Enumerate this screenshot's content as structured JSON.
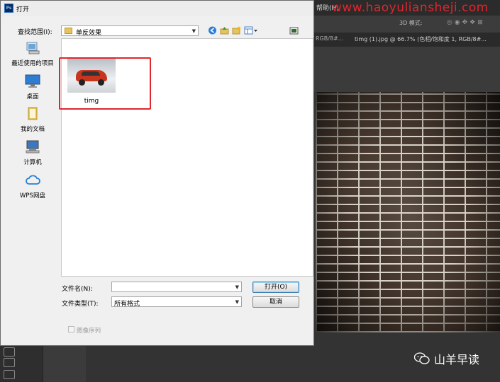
{
  "dialog": {
    "title": "打开",
    "look_in_label": "查找范围(I):",
    "look_in_value": "单反效果",
    "places": [
      {
        "label": "最近使用的项目",
        "icon": "recent-icon"
      },
      {
        "label": "桌面",
        "icon": "desktop-icon"
      },
      {
        "label": "我的文档",
        "icon": "documents-icon"
      },
      {
        "label": "计算机",
        "icon": "computer-icon"
      },
      {
        "label": "WPS网盘",
        "icon": "cloud-icon"
      }
    ],
    "files": [
      {
        "name": "timg",
        "thumbnail": "car-photo"
      }
    ],
    "file_name_label": "文件名(N):",
    "file_name_value": "",
    "file_type_label": "文件类型(T):",
    "file_type_value": "所有格式",
    "open_button": "打开(O)",
    "cancel_button": "取消",
    "image_sequence_label": "图像序列"
  },
  "background": {
    "menu_help": "帮助(H)",
    "watermark": "www.haoyuliansheji.com",
    "options_3d": "3D 模式:",
    "tab_partial": "RGB/8#...",
    "tab_active": "timg (1).jpg @ 66.7% (色相/饱和度 1, RGB/8#...",
    "brand": "山羊早读"
  },
  "colors": {
    "highlight": "#e0262d",
    "dialog_bg": "#f0f0f0",
    "ps_bg": "#333333"
  }
}
